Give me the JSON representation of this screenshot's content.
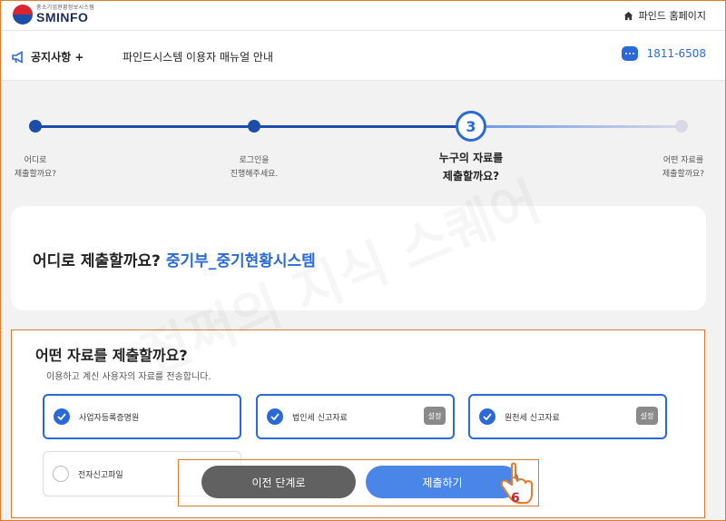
{
  "header": {
    "logo_sub": "중소기업현황정보시스템",
    "logo_main": "SMINFO",
    "home_label": "파인드 홈페이지"
  },
  "notice": {
    "label": "공지사항 +",
    "text": "파인드시스템 이용자 매뉴얼 안내",
    "phone": "1811-6508"
  },
  "stepper": {
    "current_step": "3",
    "steps": [
      {
        "line1": "어디로",
        "line2": "제출할까요?"
      },
      {
        "line1": "로그인을",
        "line2": "진행해주세요."
      },
      {
        "line1": "누구의 자료를",
        "line2": "제출할까요?"
      },
      {
        "line1": "어떤 자료를",
        "line2": "제출할까요?"
      }
    ],
    "colors": {
      "done": "#1c4ea8",
      "active": "#2a6ad8",
      "todo": "#d8d8e6"
    }
  },
  "destination": {
    "question": "어디로 제출할까요?",
    "answer": "중기부_중기현황시스템"
  },
  "documents": {
    "question": "어떤 자료를 제출할까요?",
    "subtitle": "이용하고 계신 사용자의 자료를 전송합니다.",
    "options": [
      {
        "label": "사업자등록증명원",
        "checked": true
      },
      {
        "label": "법인세 신고자료",
        "checked": true,
        "setting": "설정"
      },
      {
        "label": "원천세 신고자료",
        "checked": true,
        "setting": "설정"
      },
      {
        "label": "전자신고파일",
        "checked": false
      }
    ]
  },
  "actions": {
    "prev_label": "이전 단계로",
    "submit_label": "제출하기"
  },
  "annotation": {
    "step_number": "6"
  },
  "watermark": "전쩌의 지식 스퀘어"
}
